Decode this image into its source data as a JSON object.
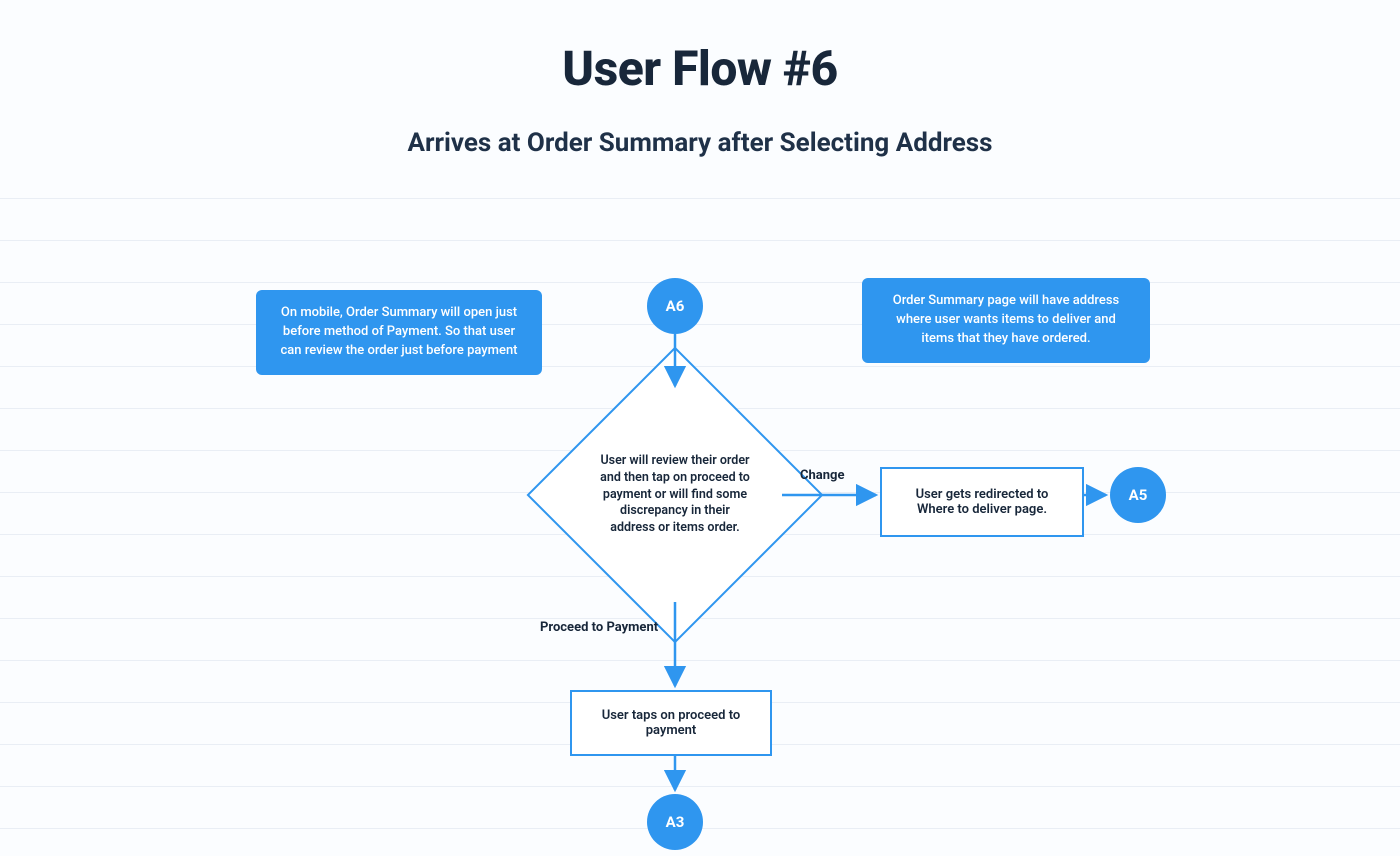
{
  "title": "User Flow #6",
  "subtitle": "Arrives at Order Summary after Selecting Address",
  "callouts": {
    "left": "On mobile, Order Summary will open just before method of  Payment. So that user can review the order just before payment",
    "right": "Order Summary page will have address where user wants items to deliver and items that they have ordered."
  },
  "nodes": {
    "start": "A6",
    "end_right": "A5",
    "end_bottom": "A3",
    "decision": "User will review their order and then tap on proceed to payment or will find some discrepancy in their address or items order.",
    "redirect": "User gets redirected to Where to deliver page.",
    "proceed": "User taps on proceed to payment"
  },
  "edges": {
    "change": "Change",
    "proceed": "Proceed to Payment"
  },
  "colors": {
    "primary": "#2f96ef",
    "ink": "#18273a"
  }
}
